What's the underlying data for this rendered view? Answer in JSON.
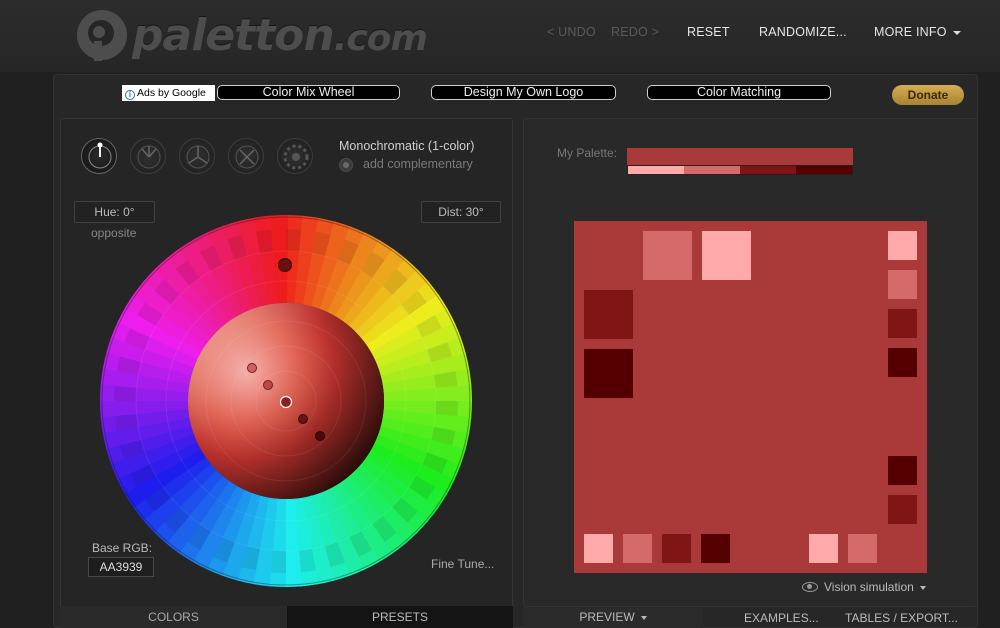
{
  "header": {
    "logo": {
      "name": "paletton",
      "suffix": ".com"
    },
    "nav": {
      "undo": "< UNDO",
      "redo": "REDO >",
      "reset": "RESET",
      "randomize": "RANDOMIZE...",
      "more_info": "MORE INFO"
    }
  },
  "adbar": {
    "ads_by": "Ads by Google",
    "links": [
      "Color Mix Wheel",
      "Design My Own Logo",
      "Color Matching"
    ],
    "donate": "Donate"
  },
  "left": {
    "scheme_icons": [
      "mono-scheme-icon",
      "adjacent-scheme-icon",
      "triad-scheme-icon",
      "tetrad-scheme-icon",
      "free-style-scheme-icon"
    ],
    "scheme_title": "Monochromatic (1-color)",
    "add_complementary": "add complementary",
    "hue": "Hue: 0°",
    "dist": "Dist: 30°",
    "opposite": "opposite",
    "base_rgb_label": "Base RGB:",
    "base_rgb_value": "AA3939",
    "fine_tune": "Fine Tune...",
    "tabs": {
      "colors": "COLORS",
      "presets": "PRESETS"
    }
  },
  "right": {
    "my_palette_label": "My Palette:",
    "palette": {
      "base": "#AA3939",
      "shades": [
        "#FFAAAA",
        "#D46A6A",
        "#801515",
        "#550000"
      ]
    },
    "preview_bg": "#AA3939",
    "vision_simulation": "Vision simulation",
    "tabs": {
      "preview": "PREVIEW",
      "examples": "EXAMPLES...",
      "tables": "TABLES / EXPORT..."
    }
  },
  "colors": {
    "accent_gold": "#c79d45",
    "background": "#202020"
  }
}
